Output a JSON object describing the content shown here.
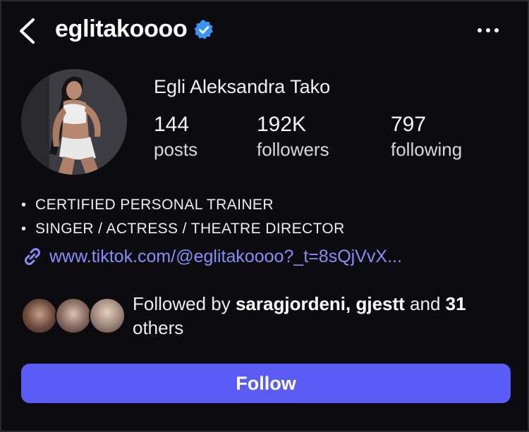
{
  "header": {
    "username": "eglitakoooo",
    "verified_icon": "verified-badge-icon",
    "back_icon": "chevron-left-icon",
    "more_icon": "more-horizontal-icon"
  },
  "profile": {
    "full_name": "Egli Aleksandra Tako",
    "avatar_icon": "profile-avatar",
    "stats": [
      {
        "value": "144",
        "label": "posts"
      },
      {
        "value": "192K",
        "label": "followers"
      },
      {
        "value": "797",
        "label": "following"
      }
    ]
  },
  "bio": {
    "lines": [
      {
        "bullet": "•",
        "text": "CERTIFIED PERSONAL TRAINER"
      },
      {
        "bullet": "•",
        "text": "SINGER / ACTRESS / THEATRE DIRECTOR"
      }
    ],
    "link_icon": "link-icon",
    "link_text": "www.tiktok.com/@eglitakoooo?_t=8sQjVvX..."
  },
  "followed_by": {
    "prefix": "Followed by ",
    "user1": "saragjordeni",
    "separator": ", ",
    "user2": "gjestt",
    "middle": " and ",
    "count": "31",
    "suffix": " others"
  },
  "actions": {
    "follow_label": "Follow"
  },
  "colors": {
    "background": "#0c0c10",
    "accent": "#5b5cf5",
    "link": "#8b8cf6",
    "verified": "#3a93f5"
  }
}
